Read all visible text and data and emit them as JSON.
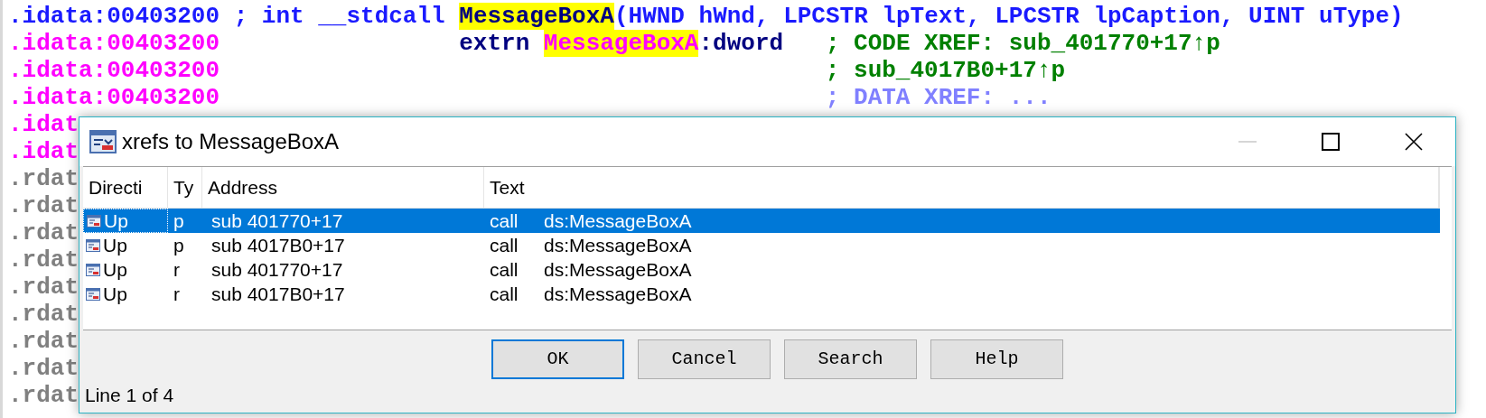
{
  "listing": [
    {
      "kind": "prototype",
      "segments": [
        {
          "kind": "address",
          "text": ".idata:00403200"
        },
        {
          "kind": "prototype",
          "text": "; int __stdcall"
        },
        {
          "kind": "function_name",
          "text": "MessageBoxA",
          "highlighted": true
        },
        {
          "kind": "parameters",
          "text": "(HWND hWnd, LPCSTR lpText, LPCSTR lpCaption, UINT uType)"
        }
      ]
    },
    {
      "kind": "import",
      "segments": [
        {
          "kind": "address",
          "text": ".idata:00403200"
        },
        {
          "kind": "keyword",
          "text": "extrn"
        },
        {
          "kind": "import_name",
          "text": "MessageBoxA",
          "highlighted": true
        },
        {
          "kind": "operand",
          "text": ":dword"
        },
        {
          "kind": "code_xref",
          "text": "; CODE XREF: sub_401770+17↑p"
        }
      ]
    },
    {
      "kind": "import",
      "segments": [
        {
          "kind": "address",
          "text": ".idata:00403200"
        },
        {
          "kind": "code_xref",
          "text": "; sub_4017B0+17↑p"
        }
      ]
    },
    {
      "kind": "import",
      "segments": [
        {
          "kind": "address",
          "text": ".idata:00403200"
        },
        {
          "kind": "data_xref",
          "text": "; DATA XREF: ..."
        }
      ]
    },
    {
      "kind": "import",
      "segments": [
        {
          "kind": "address",
          "text": ".idat"
        }
      ]
    },
    {
      "kind": "import",
      "segments": [
        {
          "kind": "address",
          "text": ".idat"
        }
      ]
    },
    {
      "kind": "data",
      "segments": [
        {
          "kind": "address",
          "text": ".rdat"
        }
      ]
    },
    {
      "kind": "data",
      "segments": [
        {
          "kind": "address",
          "text": ".rdat"
        }
      ]
    },
    {
      "kind": "data",
      "segments": [
        {
          "kind": "address",
          "text": ".rdat"
        }
      ]
    },
    {
      "kind": "data",
      "segments": [
        {
          "kind": "address",
          "text": ".rdat"
        }
      ]
    },
    {
      "kind": "data",
      "segments": [
        {
          "kind": "address",
          "text": ".rdat"
        }
      ]
    },
    {
      "kind": "data",
      "segments": [
        {
          "kind": "address",
          "text": ".rdat"
        }
      ]
    },
    {
      "kind": "data",
      "segments": [
        {
          "kind": "address",
          "text": ".rdat"
        }
      ]
    },
    {
      "kind": "data",
      "segments": [
        {
          "kind": "address",
          "text": ".rdat"
        }
      ]
    },
    {
      "kind": "data",
      "segments": [
        {
          "kind": "address",
          "text": ".rdat"
        }
      ]
    }
  ],
  "dialog": {
    "title": "xrefs to MessageBoxA",
    "window_controls": [
      {
        "kind": "minimize",
        "disabled": true
      },
      {
        "kind": "maximize",
        "disabled": false
      },
      {
        "kind": "close",
        "disabled": false
      }
    ],
    "table": {
      "columns": [
        "Directi",
        "Ty",
        "Address",
        "Text"
      ],
      "rows": [
        {
          "direction": "Up",
          "type": "p",
          "address": "sub 401770+17",
          "instruction": "call",
          "operand": "ds:MessageBoxA",
          "selected": true
        },
        {
          "direction": "Up",
          "type": "p",
          "address": "sub 4017B0+17",
          "instruction": "call",
          "operand": "ds:MessageBoxA",
          "selected": false
        },
        {
          "direction": "Up",
          "type": "r",
          "address": "sub 401770+17",
          "instruction": "call",
          "operand": "ds:MessageBoxA",
          "selected": false
        },
        {
          "direction": "Up",
          "type": "r",
          "address": "sub 4017B0+17",
          "instruction": "call",
          "operand": "ds:MessageBoxA",
          "selected": false
        }
      ]
    },
    "buttons": [
      {
        "label": "OK",
        "default": true
      },
      {
        "label": "Cancel",
        "default": false
      },
      {
        "label": "Search",
        "default": false
      },
      {
        "label": "Help",
        "default": false
      }
    ],
    "status": "Line 1 of 4"
  }
}
